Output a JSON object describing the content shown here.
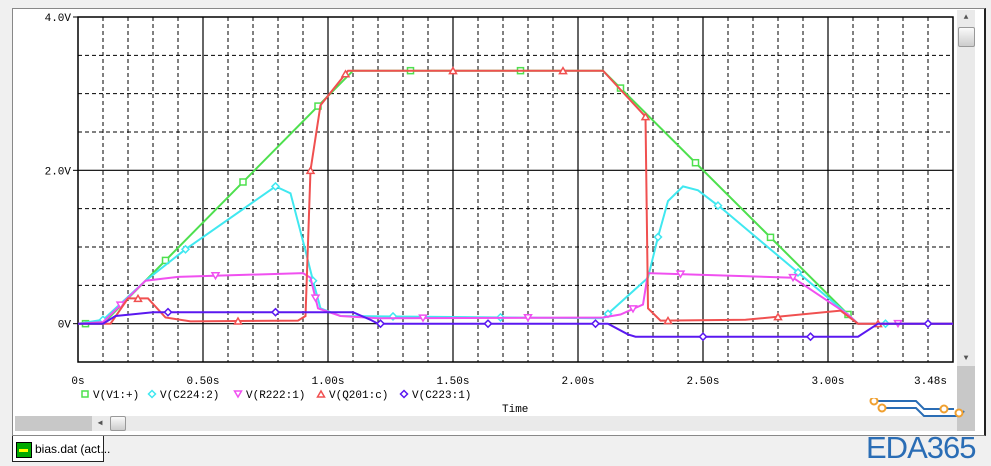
{
  "chart_data": {
    "type": "line",
    "title": "",
    "xlabel": "Time",
    "ylabel": "",
    "xlim": [
      0,
      3.5
    ],
    "ylim": [
      -0.5,
      4.0
    ],
    "grid": true,
    "x_tick_labels": [
      {
        "t": 0,
        "label": "0s"
      },
      {
        "t": 0.5,
        "label": "0.50s"
      },
      {
        "t": 1.0,
        "label": "1.00s"
      },
      {
        "t": 1.5,
        "label": "1.50s"
      },
      {
        "t": 2.0,
        "label": "2.00s"
      },
      {
        "t": 2.5,
        "label": "2.50s"
      },
      {
        "t": 3.0,
        "label": "3.00s"
      },
      {
        "t": 3.41,
        "label": "3.48s"
      }
    ],
    "y_tick_labels": [
      {
        "v": 4.0,
        "label": "4.0V"
      },
      {
        "v": 2.0,
        "label": "2.0V"
      },
      {
        "v": 0,
        "label": "0V"
      }
    ],
    "legend_placement": "bottom",
    "series": [
      {
        "name": "V(V1:+)",
        "color": "#4ee04e",
        "marker": "square",
        "points": [
          [
            0,
            0
          ],
          [
            0.1,
            0
          ],
          [
            1.1,
            3.3
          ],
          [
            2.1,
            3.3
          ],
          [
            3.08,
            0.12
          ],
          [
            3.12,
            0
          ],
          [
            3.5,
            0
          ]
        ],
        "markers": [
          0.03,
          0.35,
          0.66,
          0.96,
          1.33,
          1.77,
          2.17,
          2.47,
          2.77,
          3.08
        ]
      },
      {
        "name": "V(C224:2)",
        "color": "#40e8f0",
        "marker": "diamond",
        "points": [
          [
            0,
            0
          ],
          [
            0.1,
            0.05
          ],
          [
            0.27,
            0.56
          ],
          [
            0.43,
            0.97
          ],
          [
            0.79,
            1.79
          ],
          [
            0.85,
            1.7
          ],
          [
            0.91,
            0.95
          ],
          [
            0.94,
            0.56
          ],
          [
            0.97,
            0.2
          ],
          [
            1.05,
            0.1
          ],
          [
            2.1,
            0.07
          ],
          [
            2.28,
            0.6
          ],
          [
            2.32,
            1.13
          ],
          [
            2.36,
            1.6
          ],
          [
            2.42,
            1.79
          ],
          [
            2.48,
            1.74
          ],
          [
            2.58,
            1.49
          ],
          [
            3.08,
            0.12
          ],
          [
            3.12,
            0
          ],
          [
            3.5,
            0
          ]
        ],
        "markers": [
          0.1,
          0.43,
          0.79,
          0.94,
          1.26,
          1.69,
          2.12,
          2.32,
          2.56,
          2.88,
          3.23
        ]
      },
      {
        "name": "V(R222:1)",
        "color": "#f050f0",
        "marker": "triangle-down",
        "points": [
          [
            0,
            0
          ],
          [
            0.1,
            0.02
          ],
          [
            0.27,
            0.56
          ],
          [
            0.4,
            0.61
          ],
          [
            0.9,
            0.66
          ],
          [
            0.93,
            0.6
          ],
          [
            0.96,
            0.2
          ],
          [
            1.05,
            0.1
          ],
          [
            1.2,
            0.07
          ],
          [
            2.1,
            0.08
          ],
          [
            2.17,
            0.12
          ],
          [
            2.26,
            0.25
          ],
          [
            2.28,
            0.66
          ],
          [
            2.86,
            0.6
          ],
          [
            3.08,
            0.12
          ],
          [
            3.12,
            0
          ],
          [
            3.5,
            0
          ]
        ],
        "markers": [
          0.17,
          0.55,
          0.95,
          1.38,
          1.8,
          2.22,
          2.41,
          2.86,
          3.28
        ]
      },
      {
        "name": "V(Q201:c)",
        "color": "#f05050",
        "marker": "triangle-up",
        "points": [
          [
            0,
            0
          ],
          [
            0.13,
            0
          ],
          [
            0.2,
            0.33
          ],
          [
            0.28,
            0.33
          ],
          [
            0.35,
            0.08
          ],
          [
            0.45,
            0.03
          ],
          [
            0.88,
            0.04
          ],
          [
            0.91,
            0.1
          ],
          [
            0.93,
            2.0
          ],
          [
            0.97,
            2.85
          ],
          [
            1.08,
            3.3
          ],
          [
            2.1,
            3.3
          ],
          [
            2.27,
            2.7
          ],
          [
            2.28,
            0.2
          ],
          [
            2.33,
            0.04
          ],
          [
            2.67,
            0.05
          ],
          [
            3.05,
            0.17
          ],
          [
            3.12,
            0
          ],
          [
            3.5,
            0
          ]
        ],
        "markers": [
          0.24,
          0.64,
          0.93,
          1.07,
          1.5,
          1.94,
          2.27,
          2.36,
          2.8,
          3.2
        ]
      },
      {
        "name": "V(C223:1)",
        "color": "#5a18f0",
        "marker": "diamond",
        "points": [
          [
            0,
            0
          ],
          [
            0.1,
            0
          ],
          [
            0.15,
            0.1
          ],
          [
            0.3,
            0.15
          ],
          [
            1.1,
            0.15
          ],
          [
            1.17,
            0.05
          ],
          [
            1.2,
            0
          ],
          [
            2.12,
            0
          ],
          [
            2.2,
            -0.14
          ],
          [
            2.23,
            -0.17
          ],
          [
            3.12,
            -0.17
          ],
          [
            3.2,
            0
          ],
          [
            3.5,
            0
          ]
        ],
        "markers": [
          0.36,
          0.79,
          1.21,
          1.64,
          2.07,
          2.5,
          2.93,
          3.4
        ]
      }
    ]
  },
  "tab": {
    "label": "bias.dat (act..."
  },
  "watermark": {
    "text": "EDA365"
  }
}
